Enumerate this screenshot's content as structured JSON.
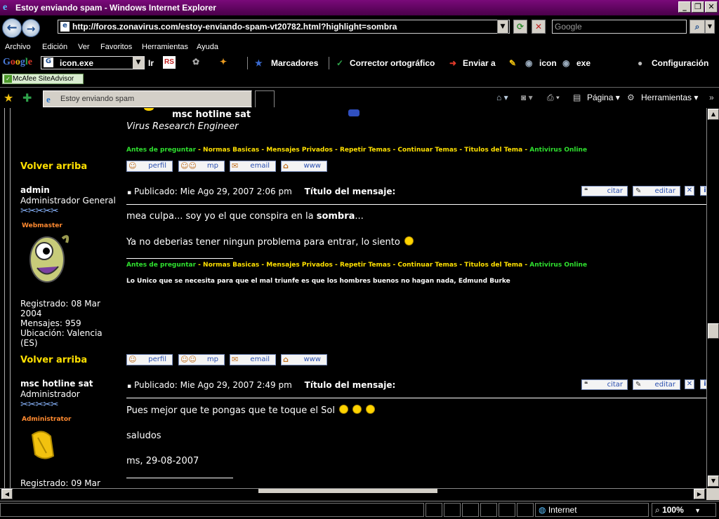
{
  "window": {
    "title": "Estoy enviando spam - Windows Internet Explorer",
    "url": "http://foros.zonavirus.com/estoy-enviando-spam-vt20782.html?highlight=sombra",
    "search_placeholder": "Google"
  },
  "menu": [
    "Archivo",
    "Edición",
    "Ver",
    "Favoritos",
    "Herramientas",
    "Ayuda"
  ],
  "google_toolbar": {
    "logo": "Google",
    "search_value": "icon.exe",
    "go_label": "Ir",
    "marcadores": "Marcadores",
    "corrector": "Corrector ortográfico",
    "enviar": "Enviar a",
    "icon_label": "icon",
    "exe_label": "exe",
    "config": "Configuración"
  },
  "mcafee": "McAfee SiteAdvisor",
  "tab": {
    "title": "Estoy enviando spam"
  },
  "command_bar": {
    "pagina": "Página",
    "herramientas": "Herramientas"
  },
  "forum": {
    "top_user": {
      "name": "msc hotline sat",
      "title": "Virus Research Engineer"
    },
    "nav_links": [
      {
        "text": "Antes de preguntar",
        "color": "green"
      },
      {
        "text": " - ",
        "color": "yellow"
      },
      {
        "text": "Normas Basicas",
        "color": "yellow"
      },
      {
        "text": " - ",
        "color": "yellow"
      },
      {
        "text": "Mensajes Privados",
        "color": "yellow"
      },
      {
        "text": " - ",
        "color": "yellow"
      },
      {
        "text": "Repetir Temas",
        "color": "yellow"
      },
      {
        "text": " - ",
        "color": "yellow"
      },
      {
        "text": "Continuar Temas",
        "color": "yellow"
      },
      {
        "text": " - ",
        "color": "yellow"
      },
      {
        "text": "Titulos del Tema",
        "color": "yellow"
      },
      {
        "text": " - ",
        "color": "yellow"
      },
      {
        "text": "Antivirus Online",
        "color": "green"
      }
    ],
    "volver": "Volver arriba",
    "profile_buttons": [
      "perfil",
      "mp",
      "email",
      "www"
    ],
    "post_buttons": [
      "citar",
      "editar"
    ],
    "posts": [
      {
        "author": "admin",
        "rank": "Administrador General",
        "role_label": "Webmaster",
        "registered": "Registrado: 08 Mar 2004",
        "registered_l1": "Registrado: 08 Mar",
        "registered_l2": "2004",
        "messages": "Mensajes: 959",
        "location_l1": "Ubicación: Valencia",
        "location_l2": "(ES)",
        "published": "Publicado: Mie Ago 29, 2007 2:06 pm",
        "subject_label": "Título del mensaje",
        "body_prefix": "mea culpa... soy yo el que conspira en la ",
        "body_highlight": "sombra",
        "body_suffix": "...",
        "body_line2": "Ya no deberias tener ningun problema para entrar, lo siento",
        "signature": "Lo Unico que se necesita para que el mal triunfe es que los hombres buenos no hagan nada, Edmund Burke"
      },
      {
        "author": "msc hotline sat",
        "rank": "Administrador",
        "role_label": "Administrator",
        "registered_l1": "Registrado: 09 Mar",
        "published": "Publicado: Mie Ago 29, 2007 2:49 pm",
        "subject_label": "Título del mensaje",
        "body_line1": "Pues mejor que te pongas que te toque el Sol",
        "body_line2": "saludos",
        "body_line3": "ms, 29-08-2007"
      }
    ]
  },
  "status": {
    "zone": "Internet",
    "zoom": "100%"
  }
}
